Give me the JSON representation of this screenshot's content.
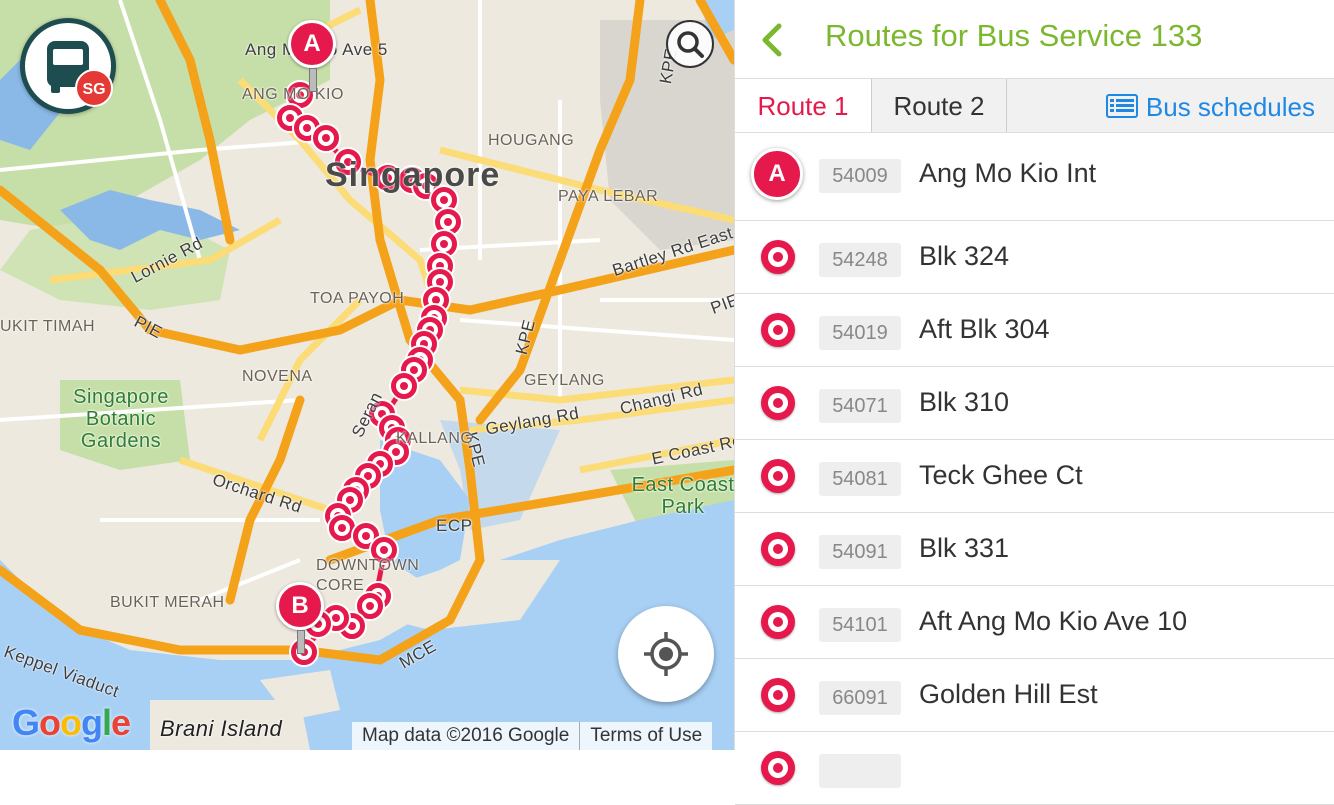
{
  "map": {
    "labels": {
      "ang_mo_kio_ave5": "Ang Mo Kio Ave 5",
      "ang_mo_kio": "ANG MO KIO",
      "hougang": "HOUGANG",
      "singapore": "Singapore",
      "paya_lebar": "PAYA LEBAR",
      "lornie_rd": "Lornie Rd",
      "toa_payoh": "TOA PAYOH",
      "bartley_rd_east": "Bartley Rd East",
      "bukit_timah": "UKIT TIMAH",
      "pie_left": "PIE",
      "pie_right": "PIE",
      "kpe_top": "KPE",
      "kpe_mid": "KPE",
      "kpe_low": "KPE",
      "novena": "NOVENA",
      "geylang": "GEYLANG",
      "changi_rd": "Changi Rd",
      "geylang_rd": "Geylang Rd",
      "botanic": "Singapore Botanic Gardens",
      "serangoon": "Seran",
      "kallang": "KALLANG",
      "orchard_rd": "Orchard Rd",
      "e_coast_rd": "E Coast Rd",
      "east_coast_park": "East Coast Park",
      "ecp": "ECP",
      "downtown_core": "DOWNTOWN CORE",
      "bukit_merah": "BUKIT MERAH",
      "mce": "MCE",
      "keppel_viaduct": "Keppel Viaduct",
      "ta": "Ta"
    },
    "marker_start": "A",
    "marker_end": "B",
    "google": "Google",
    "brani_island": "Brani Island",
    "attribution": "Map data ©2016 Google",
    "terms": "Terms of Use",
    "logo_badge": "SG"
  },
  "panel": {
    "title": "Routes for Bus Service 133",
    "tabs": [
      "Route 1",
      "Route 2"
    ],
    "active_tab": "Route 1",
    "schedules_label": "Bus schedules",
    "stops": [
      {
        "marker": "A",
        "code": "54009",
        "name": "Ang Mo Kio Int"
      },
      {
        "code": "54248",
        "name": "Blk 324"
      },
      {
        "code": "54019",
        "name": "Aft Blk 304"
      },
      {
        "code": "54071",
        "name": "Blk 310"
      },
      {
        "code": "54081",
        "name": "Teck Ghee Ct"
      },
      {
        "code": "54091",
        "name": "Blk 331"
      },
      {
        "code": "54101",
        "name": "Aft Ang Mo Kio Ave 10"
      },
      {
        "code": "66091",
        "name": "Golden Hill Est"
      },
      {
        "code": "",
        "name": ""
      }
    ]
  },
  "colors": {
    "accent_green": "#7cb82f",
    "route_red": "#e5194b",
    "link_blue": "#1e88e5",
    "expressway_orange": "#f5a21b",
    "road_yellow": "#fbdc76",
    "water": "#a8d0f5",
    "park": "#c6dfa8"
  }
}
